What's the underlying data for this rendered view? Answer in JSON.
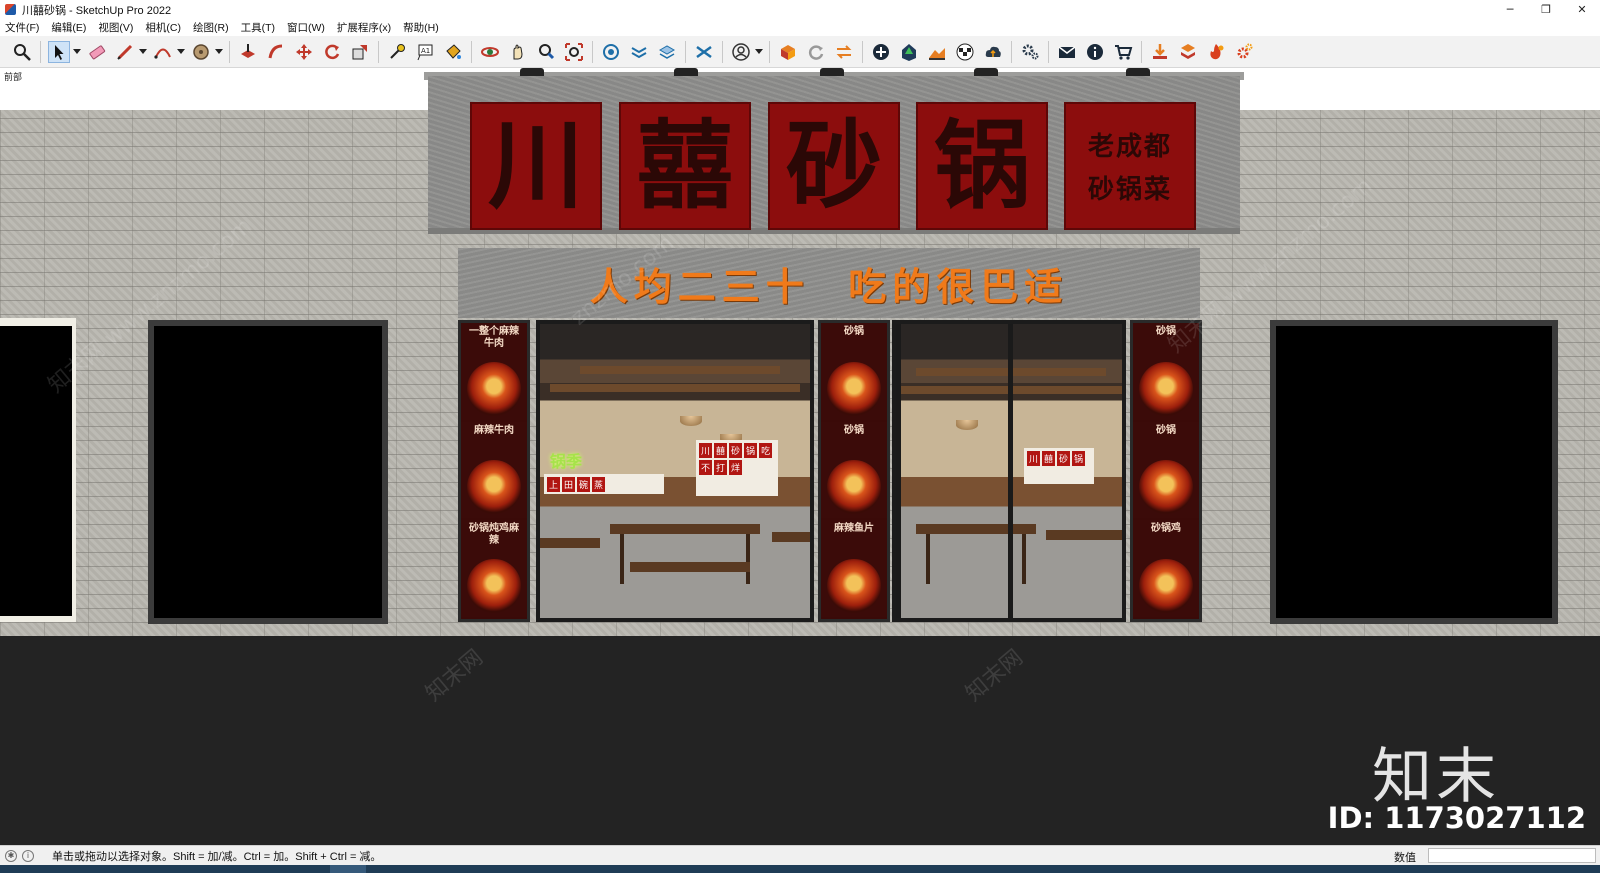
{
  "window": {
    "title": "川囍砂锅 - SketchUp Pro 2022",
    "controls": {
      "minimize": "─",
      "restore": "❐",
      "close": "✕"
    }
  },
  "menu": [
    "文件(F)",
    "编辑(E)",
    "视图(V)",
    "相机(C)",
    "绘图(R)",
    "工具(T)",
    "窗口(W)",
    "扩展程序(x)",
    "帮助(H)"
  ],
  "toolbar": {
    "active_tool": "select-tool",
    "tools": [
      "zoom-icon",
      "select-icon",
      "eraser-icon",
      "pencil-icon",
      "arc-icon",
      "circle-icon",
      "push-pull-icon",
      "follow-me-icon",
      "move-icon",
      "rotate-icon",
      "scale-icon",
      "tape-measure-icon",
      "text-icon",
      "paint-bucket-icon",
      "orbit-icon",
      "pan-icon",
      "zoom-window-icon",
      "zoom-extents-icon",
      "gear-icon",
      "mail-icon",
      "info-icon",
      "cart-icon"
    ]
  },
  "viewport": {
    "scene_label": "前部",
    "storefront": {
      "sign_chars": [
        "川",
        "囍",
        "砂",
        "锅"
      ],
      "sign_small_lines": [
        "老成都",
        "砂锅菜"
      ],
      "slogan": "人均二三十  吃的很巴适",
      "left_poster_texts": [
        "一整个麻辣牛肉",
        "麻辣牛肉",
        "砂锅炖鸡麻辣"
      ],
      "mid_poster_texts": [
        "砂锅",
        "砂锅",
        "麻辣鱼片"
      ],
      "right_poster_texts": [
        "砂锅",
        "砂锅",
        "砂锅鸡"
      ],
      "interior_neon": "锅季",
      "interior_menu": [
        "上",
        "田",
        "碗",
        "蒸"
      ],
      "interior_menu_board": [
        "川",
        "囍",
        "砂",
        "锅",
        "吃",
        "不",
        "打",
        "烊"
      ]
    },
    "watermarks": [
      "知末网 www.znzmo.com",
      "znzmo.com",
      "知末网",
      "知末网",
      "知末网 www.znzmo.com"
    ],
    "brand": {
      "logo": "知末",
      "id": "ID: 1173027112"
    }
  },
  "statusbar": {
    "message": "单击或拖动以选择对象。Shift = 加/减。Ctrl = 加。Shift + Ctrl = 减。",
    "vcb_label": "数值",
    "vcb_value": ""
  },
  "colors": {
    "sign_red": "#8c0d0d",
    "slogan_orange": "#f07a1a",
    "wall_gray": "#b9b7b0",
    "ground": "#232323"
  }
}
